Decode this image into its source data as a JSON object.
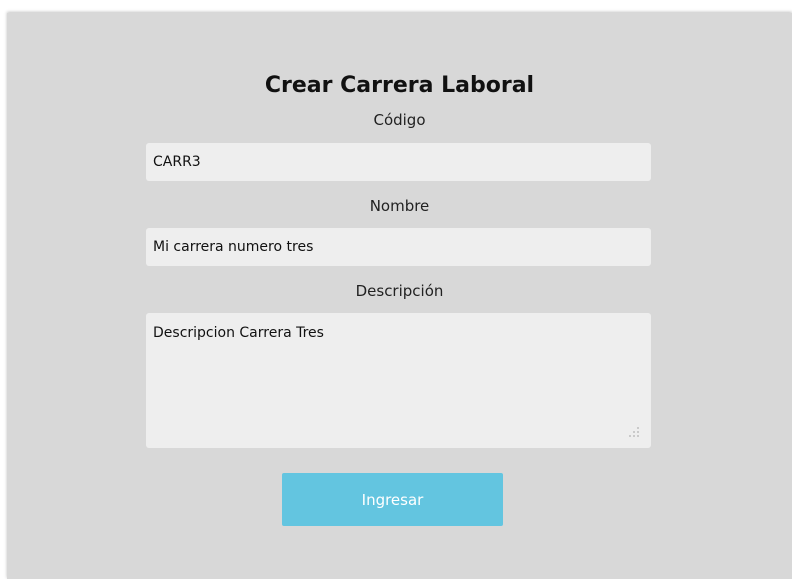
{
  "form": {
    "title": "Crear Carrera Laboral",
    "codigo": {
      "label": "Código",
      "value": "CARR3"
    },
    "nombre": {
      "label": "Nombre",
      "value": "Mi carrera numero tres"
    },
    "descripcion": {
      "label": "Descripción",
      "value": "Descripcion Carrera Tres"
    },
    "submit_label": "Ingresar"
  },
  "colors": {
    "panel_background": "#d8d8d8",
    "field_background": "#eeeeee",
    "button_background": "#63c5e0",
    "button_text": "#ffffff"
  },
  "icons": {
    "textarea_resize": "resize-grip-icon"
  }
}
